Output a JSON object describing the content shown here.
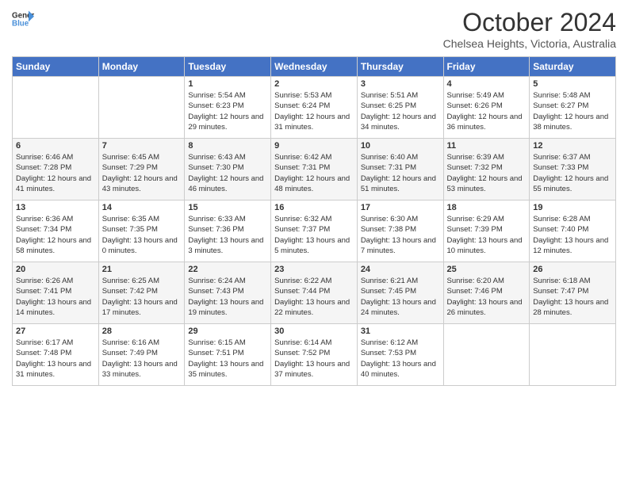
{
  "header": {
    "title": "October 2024",
    "location": "Chelsea Heights, Victoria, Australia"
  },
  "days": [
    "Sunday",
    "Monday",
    "Tuesday",
    "Wednesday",
    "Thursday",
    "Friday",
    "Saturday"
  ],
  "weeks": [
    [
      {
        "day": "",
        "info": ""
      },
      {
        "day": "",
        "info": ""
      },
      {
        "day": "1",
        "info": "Sunrise: 5:54 AM\nSunset: 6:23 PM\nDaylight: 12 hours and 29 minutes."
      },
      {
        "day": "2",
        "info": "Sunrise: 5:53 AM\nSunset: 6:24 PM\nDaylight: 12 hours and 31 minutes."
      },
      {
        "day": "3",
        "info": "Sunrise: 5:51 AM\nSunset: 6:25 PM\nDaylight: 12 hours and 34 minutes."
      },
      {
        "day": "4",
        "info": "Sunrise: 5:49 AM\nSunset: 6:26 PM\nDaylight: 12 hours and 36 minutes."
      },
      {
        "day": "5",
        "info": "Sunrise: 5:48 AM\nSunset: 6:27 PM\nDaylight: 12 hours and 38 minutes."
      }
    ],
    [
      {
        "day": "6",
        "info": "Sunrise: 6:46 AM\nSunset: 7:28 PM\nDaylight: 12 hours and 41 minutes."
      },
      {
        "day": "7",
        "info": "Sunrise: 6:45 AM\nSunset: 7:29 PM\nDaylight: 12 hours and 43 minutes."
      },
      {
        "day": "8",
        "info": "Sunrise: 6:43 AM\nSunset: 7:30 PM\nDaylight: 12 hours and 46 minutes."
      },
      {
        "day": "9",
        "info": "Sunrise: 6:42 AM\nSunset: 7:31 PM\nDaylight: 12 hours and 48 minutes."
      },
      {
        "day": "10",
        "info": "Sunrise: 6:40 AM\nSunset: 7:31 PM\nDaylight: 12 hours and 51 minutes."
      },
      {
        "day": "11",
        "info": "Sunrise: 6:39 AM\nSunset: 7:32 PM\nDaylight: 12 hours and 53 minutes."
      },
      {
        "day": "12",
        "info": "Sunrise: 6:37 AM\nSunset: 7:33 PM\nDaylight: 12 hours and 55 minutes."
      }
    ],
    [
      {
        "day": "13",
        "info": "Sunrise: 6:36 AM\nSunset: 7:34 PM\nDaylight: 12 hours and 58 minutes."
      },
      {
        "day": "14",
        "info": "Sunrise: 6:35 AM\nSunset: 7:35 PM\nDaylight: 13 hours and 0 minutes."
      },
      {
        "day": "15",
        "info": "Sunrise: 6:33 AM\nSunset: 7:36 PM\nDaylight: 13 hours and 3 minutes."
      },
      {
        "day": "16",
        "info": "Sunrise: 6:32 AM\nSunset: 7:37 PM\nDaylight: 13 hours and 5 minutes."
      },
      {
        "day": "17",
        "info": "Sunrise: 6:30 AM\nSunset: 7:38 PM\nDaylight: 13 hours and 7 minutes."
      },
      {
        "day": "18",
        "info": "Sunrise: 6:29 AM\nSunset: 7:39 PM\nDaylight: 13 hours and 10 minutes."
      },
      {
        "day": "19",
        "info": "Sunrise: 6:28 AM\nSunset: 7:40 PM\nDaylight: 13 hours and 12 minutes."
      }
    ],
    [
      {
        "day": "20",
        "info": "Sunrise: 6:26 AM\nSunset: 7:41 PM\nDaylight: 13 hours and 14 minutes."
      },
      {
        "day": "21",
        "info": "Sunrise: 6:25 AM\nSunset: 7:42 PM\nDaylight: 13 hours and 17 minutes."
      },
      {
        "day": "22",
        "info": "Sunrise: 6:24 AM\nSunset: 7:43 PM\nDaylight: 13 hours and 19 minutes."
      },
      {
        "day": "23",
        "info": "Sunrise: 6:22 AM\nSunset: 7:44 PM\nDaylight: 13 hours and 22 minutes."
      },
      {
        "day": "24",
        "info": "Sunrise: 6:21 AM\nSunset: 7:45 PM\nDaylight: 13 hours and 24 minutes."
      },
      {
        "day": "25",
        "info": "Sunrise: 6:20 AM\nSunset: 7:46 PM\nDaylight: 13 hours and 26 minutes."
      },
      {
        "day": "26",
        "info": "Sunrise: 6:18 AM\nSunset: 7:47 PM\nDaylight: 13 hours and 28 minutes."
      }
    ],
    [
      {
        "day": "27",
        "info": "Sunrise: 6:17 AM\nSunset: 7:48 PM\nDaylight: 13 hours and 31 minutes."
      },
      {
        "day": "28",
        "info": "Sunrise: 6:16 AM\nSunset: 7:49 PM\nDaylight: 13 hours and 33 minutes."
      },
      {
        "day": "29",
        "info": "Sunrise: 6:15 AM\nSunset: 7:51 PM\nDaylight: 13 hours and 35 minutes."
      },
      {
        "day": "30",
        "info": "Sunrise: 6:14 AM\nSunset: 7:52 PM\nDaylight: 13 hours and 37 minutes."
      },
      {
        "day": "31",
        "info": "Sunrise: 6:12 AM\nSunset: 7:53 PM\nDaylight: 13 hours and 40 minutes."
      },
      {
        "day": "",
        "info": ""
      },
      {
        "day": "",
        "info": ""
      }
    ]
  ]
}
